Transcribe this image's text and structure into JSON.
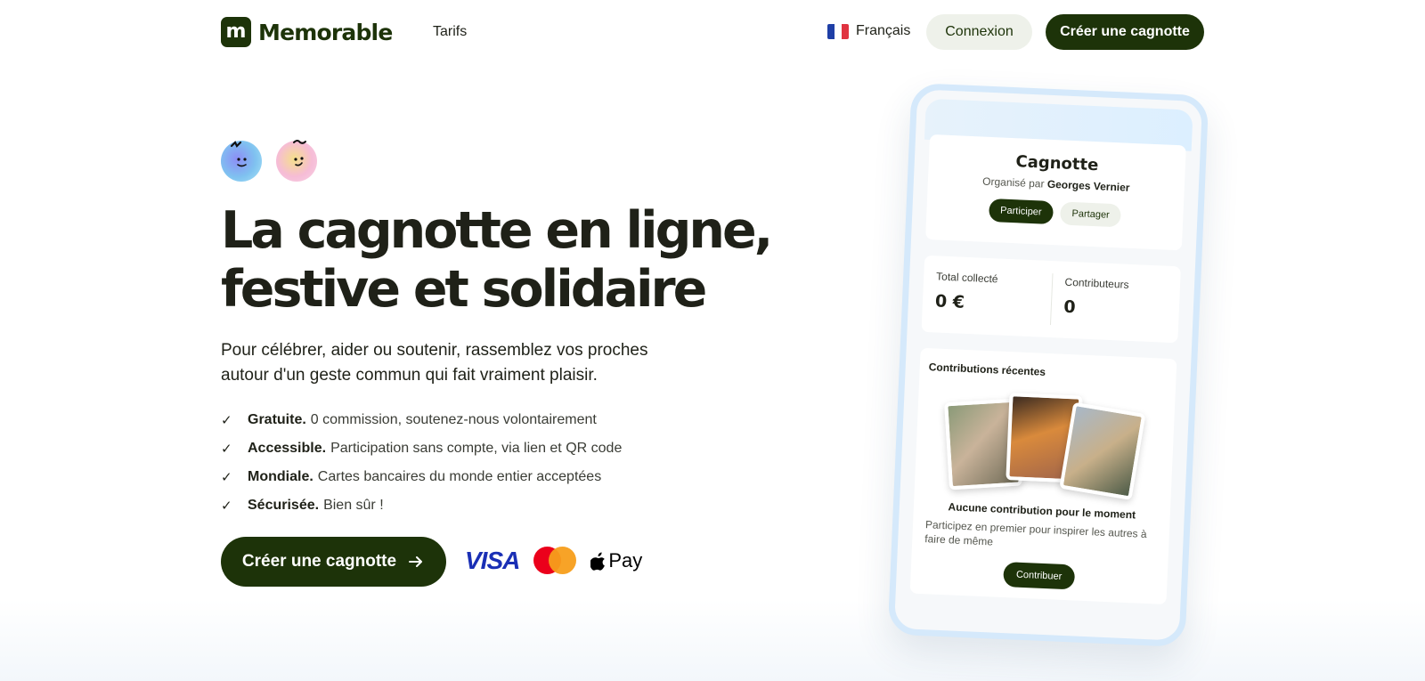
{
  "header": {
    "logo_letter": "m",
    "logo_text": "Memorable",
    "nav_tarifs": "Tarifs",
    "language": "Français",
    "login_label": "Connexion",
    "create_label": "Créer une cagnotte"
  },
  "hero": {
    "headline_line1": "La cagnotte en ligne,",
    "headline_line2": "festive et solidaire",
    "subtitle_line1": "Pour célébrer, aider ou soutenir, rassemblez vos proches",
    "subtitle_line2": "autour d'un geste commun qui fait vraiment plaisir.",
    "features": [
      {
        "title": "Gratuite.",
        "text": "0 commission, soutenez-nous volontairement"
      },
      {
        "title": "Accessible.",
        "text": "Participation sans compte, via lien et QR code"
      },
      {
        "title": "Mondiale.",
        "text": "Cartes bancaires du monde entier acceptées"
      },
      {
        "title": "Sécurisée.",
        "text": "Bien sûr !"
      }
    ],
    "cta_label": "Créer une cagnotte",
    "payments": {
      "visa": "VISA",
      "apple_pay": "Pay"
    }
  },
  "phone": {
    "title": "Cagnotte",
    "organized_by_prefix": "Organisé par",
    "organizer": "Georges Vernier",
    "participate_label": "Participer",
    "share_label": "Partager",
    "total_label": "Total collecté",
    "total_value": "0 €",
    "contributors_label": "Contributeurs",
    "contributors_value": "0",
    "recent_title": "Contributions récentes",
    "empty_title": "Aucune contribution pour le moment",
    "empty_sub": "Participez en premier pour inspirer les autres à faire de même",
    "contribute_label": "Contribuer"
  },
  "colors": {
    "brand_dark_green": "#1d3309",
    "light_pill": "#eef1ea",
    "visa_blue": "#1a2fb5",
    "mastercard_red": "#eb001b",
    "mastercard_orange": "#f79e1b",
    "phone_border": "#d5e9fb"
  },
  "icons": [
    "logo-mark",
    "france-flag-icon",
    "check-icon",
    "arrow-right-icon",
    "visa-logo",
    "mastercard-logo",
    "apple-icon"
  ]
}
